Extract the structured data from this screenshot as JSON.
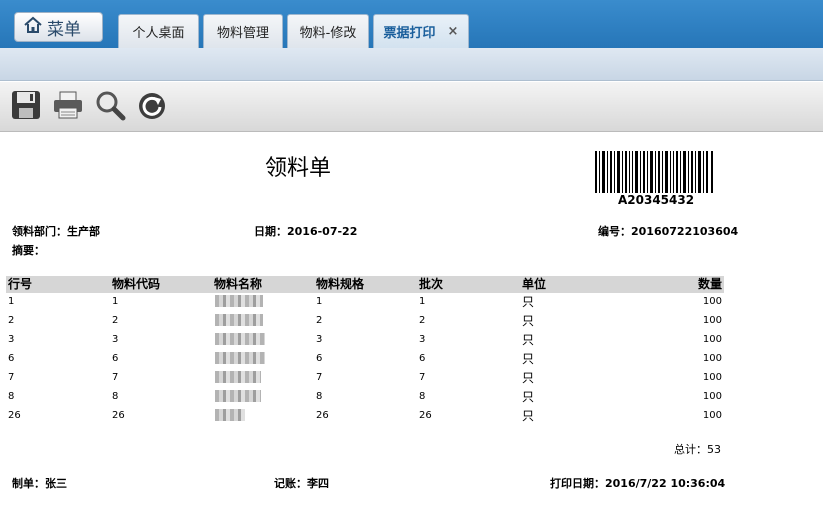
{
  "header": {
    "menu_label": "菜单",
    "tabs": [
      {
        "label": "个人桌面"
      },
      {
        "label": "物料管理"
      },
      {
        "label": "物料-修改"
      },
      {
        "label": "票据打印",
        "active": true
      }
    ],
    "close_glyph": "×"
  },
  "toolbar": {
    "buttons": [
      {
        "icon": "save-icon"
      },
      {
        "icon": "print-icon"
      },
      {
        "icon": "preview-icon"
      },
      {
        "icon": "refresh-icon"
      }
    ]
  },
  "document": {
    "title": "领料单",
    "barcode_text": "A20345432",
    "department": "领料部门：生产部",
    "date": "日期：2016-07-22",
    "number": "编号：20160722103604",
    "summary": "摘要：",
    "columns": [
      "行号",
      "物料代码",
      "物料名称",
      "物料规格",
      "批次",
      "单位",
      "数量"
    ],
    "rows": [
      {
        "line": "1",
        "code": "1",
        "spec": "1",
        "batch": "1",
        "unit": "只",
        "qty": "100"
      },
      {
        "line": "2",
        "code": "2",
        "spec": "2",
        "batch": "2",
        "unit": "只",
        "qty": "100"
      },
      {
        "line": "3",
        "code": "3",
        "spec": "3",
        "batch": "3",
        "unit": "只",
        "qty": "100"
      },
      {
        "line": "6",
        "code": "6",
        "spec": "6",
        "batch": "6",
        "unit": "只",
        "qty": "100"
      },
      {
        "line": "7",
        "code": "7",
        "spec": "7",
        "batch": "7",
        "unit": "只",
        "qty": "100"
      },
      {
        "line": "8",
        "code": "8",
        "spec": "8",
        "batch": "8",
        "unit": "只",
        "qty": "100"
      },
      {
        "line": "26",
        "code": "26",
        "spec": "26",
        "batch": "26",
        "unit": "只",
        "qty": "100"
      }
    ],
    "total": "总计：53",
    "maker": "制单：张三",
    "bookkeeper": "记账：李四",
    "print_date": "打印日期：2016/7/22 10:36:04"
  }
}
